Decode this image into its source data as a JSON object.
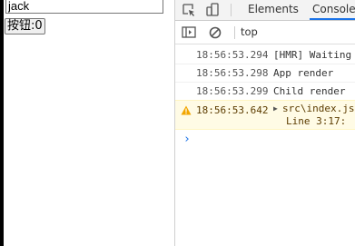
{
  "app": {
    "input_value": "jack",
    "button_label": "按钮:0"
  },
  "devtools": {
    "tabs": [
      {
        "label": "Elements",
        "active": false
      },
      {
        "label": "Console",
        "active": true
      }
    ],
    "toolbar": {
      "context": "top"
    },
    "logs": [
      {
        "time": "18:56:53.294",
        "message": "[HMR] Waiting for update signal from WDS...",
        "level": "info"
      },
      {
        "time": "18:56:53.298",
        "message": "App render",
        "level": "info"
      },
      {
        "time": "18:56:53.299",
        "message": "Child render",
        "level": "info"
      },
      {
        "time": "18:56:53.642",
        "source": "src\\index.js",
        "line": "Line 3:17:",
        "level": "warning"
      }
    ],
    "prompt_symbol": "›"
  },
  "colors": {
    "accent": "#1a73e8",
    "warning_bg": "#fffbe5",
    "warning_text": "#5c3c00"
  }
}
